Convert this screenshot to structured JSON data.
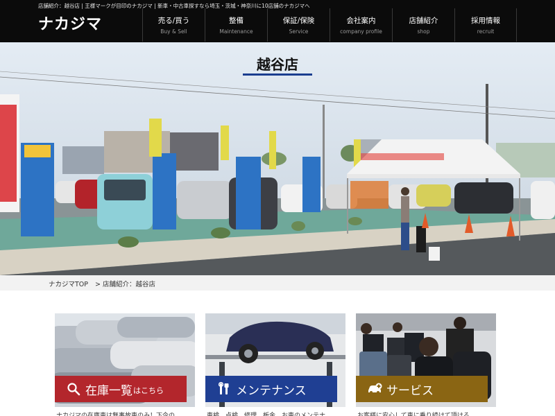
{
  "header": {
    "tagline": "店舗紹介：越谷店 | 王様マークが目印のナカジマ | 新車・中古車探すなら埼玉・茨城・神奈川に10店舗のナカジマへ",
    "logo": "ナカジマ"
  },
  "nav": [
    {
      "jp": "売る/買う",
      "en": "Buy & Sell"
    },
    {
      "jp": "整備",
      "en": "Maintenance"
    },
    {
      "jp": "保証/保険",
      "en": "Service"
    },
    {
      "jp": "会社案内",
      "en": "company profile"
    },
    {
      "jp": "店舗紹介",
      "en": "shop"
    },
    {
      "jp": "採用情報",
      "en": "recruit"
    }
  ],
  "hero": {
    "title": "越谷店"
  },
  "breadcrumb": {
    "home": "ナカジマTOP",
    "current": "> 店舗紹介：越谷店"
  },
  "cards": [
    {
      "main": "在庫一覧",
      "sub": "はこちら",
      "desc": "ナカジマの在庫車は無事故車のみ！下今の",
      "color": "#b3262c",
      "icon": "search-icon"
    },
    {
      "main": "メンテナンス",
      "sub": "",
      "desc": "車検、点検、修理、板金、お車のメンテナ",
      "color": "#1f3f93",
      "icon": "tools-icon"
    },
    {
      "main": "サービス",
      "sub": "",
      "desc": "お客様に安心して車に乗り続けて頂ける",
      "color": "#8a6513",
      "icon": "car-plus-icon"
    }
  ]
}
